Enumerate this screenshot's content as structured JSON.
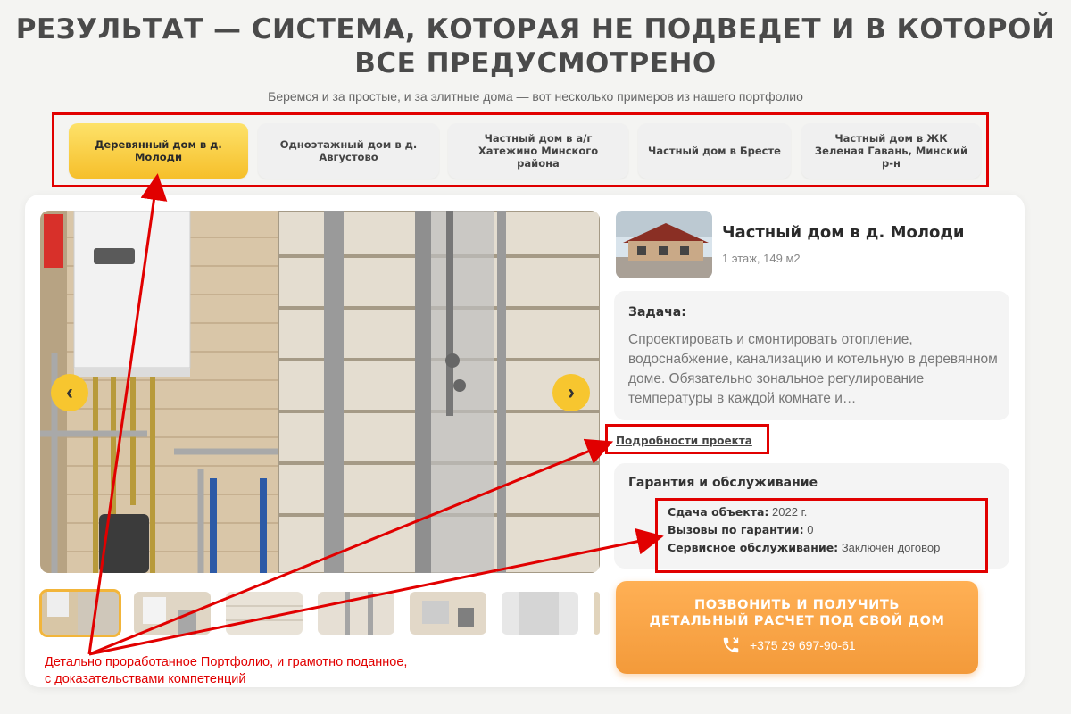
{
  "header": {
    "title_line1": "РЕЗУЛЬТАТ — СИСТЕМА, КОТОРАЯ НЕ ПОДВЕДЕТ И В КОТОРОЙ",
    "title_line2": "ВСЕ ПРЕДУСМОТРЕНО",
    "subtitle": "Беремся и за простые, и за элитные дома — вот несколько примеров из нашего портфолио"
  },
  "tabs": [
    {
      "label": "Деревянный дом в д. Молоди",
      "active": true
    },
    {
      "label": "Одноэтажный дом в д. Августово",
      "active": false
    },
    {
      "label": "Частный дом в а/г Хатежино Минского района",
      "active": false
    },
    {
      "label": "Частный дом в Бресте",
      "active": false
    },
    {
      "label": "Частный дом в ЖК Зеленая Гавань, Минский р-н",
      "active": false
    }
  ],
  "gallery": {
    "prev_icon": "chevron-left-icon",
    "next_icon": "chevron-right-icon",
    "prev_glyph": "‹",
    "next_glyph": "›",
    "thumbnail_count": 7,
    "active_thumbnail": 1
  },
  "project": {
    "title": "Частный дом в д. Молоди",
    "subtitle": "1 этаж, 149 м2",
    "task_heading": "Задача:",
    "task_text": "Спроектировать и смонтировать отопление, водоснабжение, канализацию и котельную в деревянном доме. Обязательно зональное регулирование температуры в каждой комнате и…",
    "details_link": "Подробности проекта",
    "guarantee_heading": "Гарантия и обслуживание",
    "guarantee": [
      {
        "label": "Сдача объекта:",
        "value": "2022 г."
      },
      {
        "label": "Вызовы по гарантии:",
        "value": "0"
      },
      {
        "label": "Сервисное обслуживание:",
        "value": "Заключен договор"
      }
    ]
  },
  "cta": {
    "line1": "ПОЗВОНИТЬ И ПОЛУЧИТЬ",
    "line2": "ДЕТАЛЬНЫЙ РАСЧЕТ ПОД СВОЙ ДОМ",
    "phone": "+375 29 697-90-61",
    "icon": "phone-icon"
  },
  "annotation": {
    "line1": "Детально проработанное Портфолио, и грамотно поданное,",
    "line2": "с доказательствами компетенций",
    "color": "#e10000"
  },
  "colors": {
    "accent_yellow": "#f6bf2a",
    "cta_orange": "#f39a3a",
    "annotation_red": "#e10000"
  }
}
